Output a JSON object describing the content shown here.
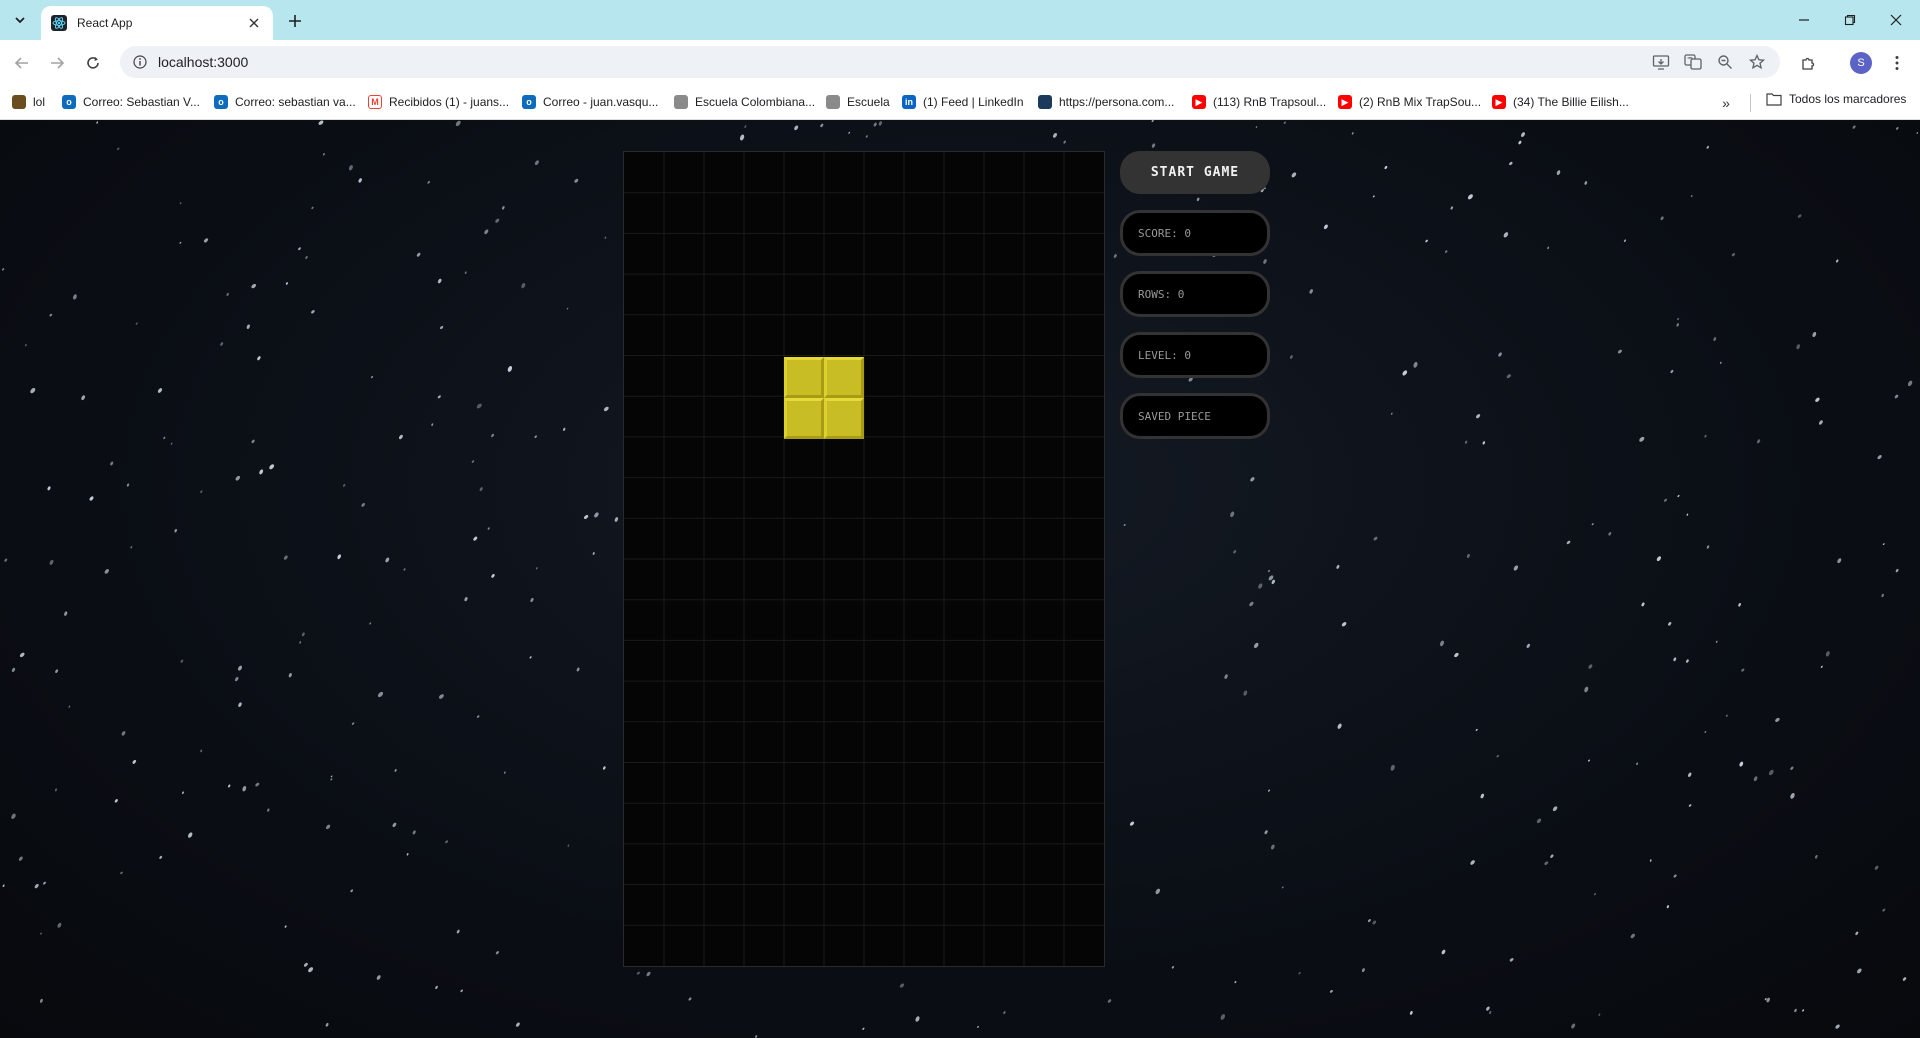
{
  "browser": {
    "tab_title": "React App",
    "url": "localhost:3000",
    "profile_initial": "S",
    "bookmarks": [
      {
        "label": "lol",
        "color": "#6b4e1f"
      },
      {
        "label": "Correo: Sebastian V...",
        "color": "#0f6cbd"
      },
      {
        "label": "Correo: sebastian va...",
        "color": "#0f6cbd"
      },
      {
        "label": "Recibidos (1) - juans...",
        "color": "#ea4335"
      },
      {
        "label": "Correo - juan.vasqu...",
        "color": "#0f6cbd"
      },
      {
        "label": "Escuela Colombiana...",
        "color": "#8a8a8a"
      },
      {
        "label": "Escuela",
        "color": "#8a8a8a"
      },
      {
        "label": "(1) Feed | LinkedIn",
        "color": "#0a66c2"
      },
      {
        "label": "https://persona.com...",
        "color": "#1b3a5c"
      },
      {
        "label": "(113) RnB Trapsoul...",
        "color": "#ff0000"
      },
      {
        "label": "(2) RnB Mix TrapSou...",
        "color": "#ff0000"
      },
      {
        "label": "(34) The Billie Eilish...",
        "color": "#ff0000"
      }
    ],
    "all_bookmarks_label": "Todos los marcadores"
  },
  "game": {
    "start_label": "START GAME",
    "score_label": "SCORE: 0",
    "rows_label": "ROWS: 0",
    "level_label": "LEVEL: 0",
    "saved_piece_label": "SAVED PIECE",
    "stage_cols": 12,
    "stage_rows": 20,
    "piece": "O",
    "piece_color": "#c9bd25"
  },
  "colors": {
    "tabstrip": "#b8e6ef",
    "button_bg": "#333333",
    "display_border": "#333333"
  }
}
